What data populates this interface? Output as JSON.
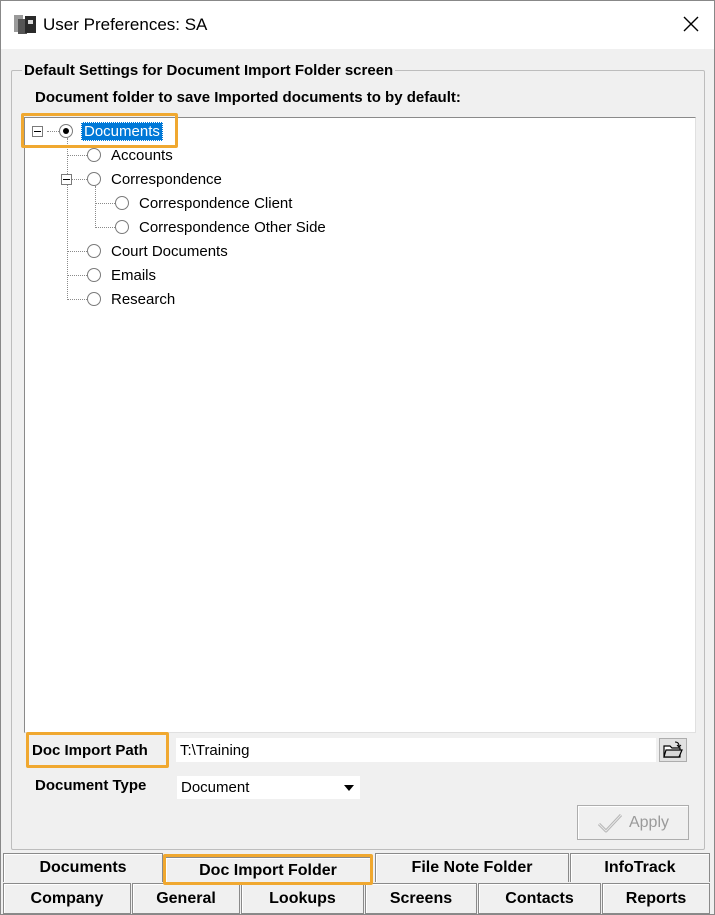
{
  "window": {
    "title": "User Preferences: SA"
  },
  "group": {
    "title": "Default Settings for Document Import Folder screen",
    "tree_label": "Document folder to save Imported documents to by default:"
  },
  "tree": {
    "root": "Documents",
    "items": [
      "Accounts",
      "Correspondence",
      "Correspondence Client",
      "Correspondence Other Side",
      "Court Documents",
      "Emails",
      "Research"
    ]
  },
  "fields": {
    "doc_import_path_label": "Doc Import Path",
    "doc_import_path_value": "T:\\Training",
    "document_type_label": "Document Type",
    "document_type_value": "Document"
  },
  "buttons": {
    "apply": "Apply"
  },
  "tabs": {
    "row_top": [
      "Documents",
      "Doc Import Folder",
      "File Note Folder",
      "InfoTrack"
    ],
    "row_bottom": [
      "Company",
      "General",
      "Lookups",
      "Screens",
      "Contacts",
      "Reports"
    ],
    "active": "Doc Import Folder"
  },
  "colors": {
    "highlight": "#f0a830",
    "selection": "#0078d7"
  }
}
